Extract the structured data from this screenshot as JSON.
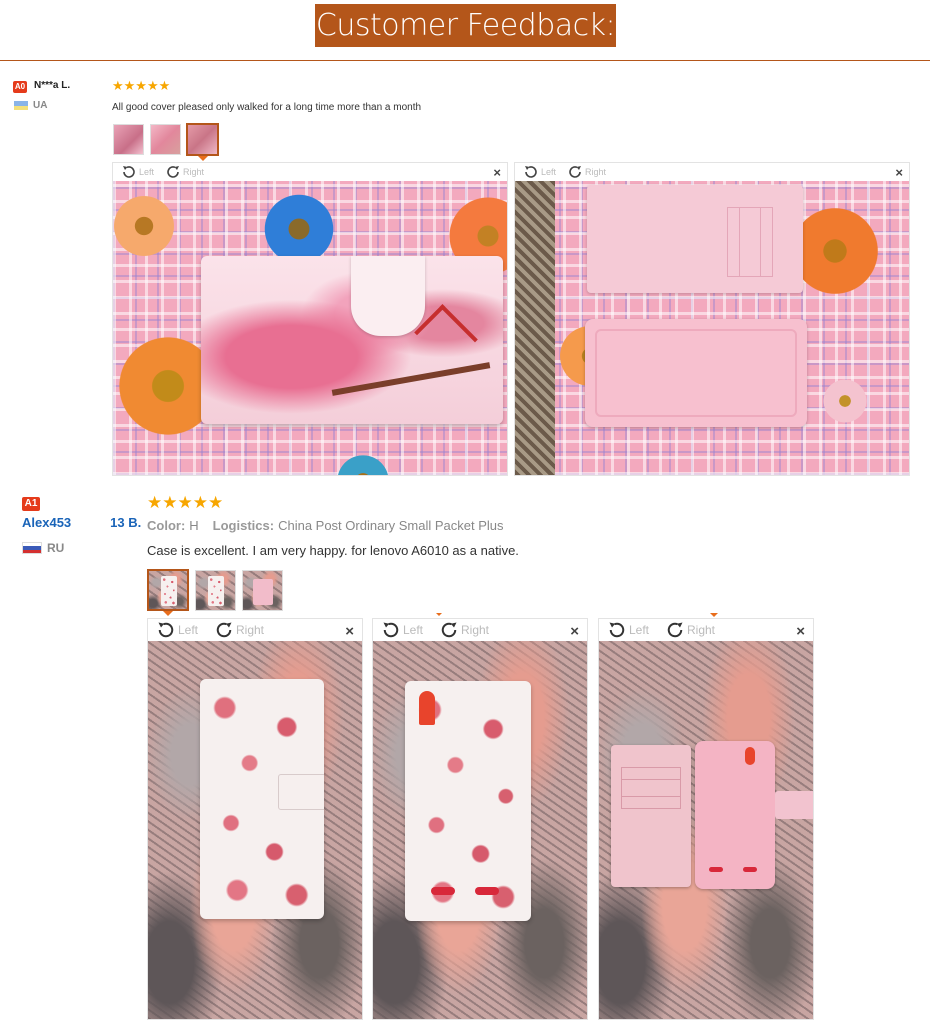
{
  "header": {
    "title": "Customer Feedback:"
  },
  "reviews": [
    {
      "badge": "A0",
      "name": "N***a L.",
      "country": "UA",
      "stars": "★★★★★",
      "text": "All good cover pleased only walked for a long time more than a month",
      "viewer": {
        "left_label": "Left",
        "right_label": "Right",
        "close": "×"
      }
    },
    {
      "badge": "A1",
      "name": "Alex453   13 B.",
      "country": "RU",
      "stars": "★★★★★",
      "color_label": "Color:",
      "color_value": "H",
      "logistics_label": "Logistics:",
      "logistics_value": "China Post Ordinary Small Packet Plus",
      "text": "Case is excellent. I am very happy. for lenovo A6010 as a native.",
      "viewer": {
        "left_label": "Left",
        "right_label": "Right",
        "close": "×"
      }
    }
  ],
  "colors": {
    "accent": "#b4561a",
    "badge": "#e53b1b",
    "stars": "#f7a600",
    "name_blue": "#1a64b8"
  },
  "icons": [
    "rotate-left-icon",
    "rotate-right-icon",
    "close-icon",
    "flag-ua-icon",
    "flag-ru-icon",
    "star-icon"
  ]
}
